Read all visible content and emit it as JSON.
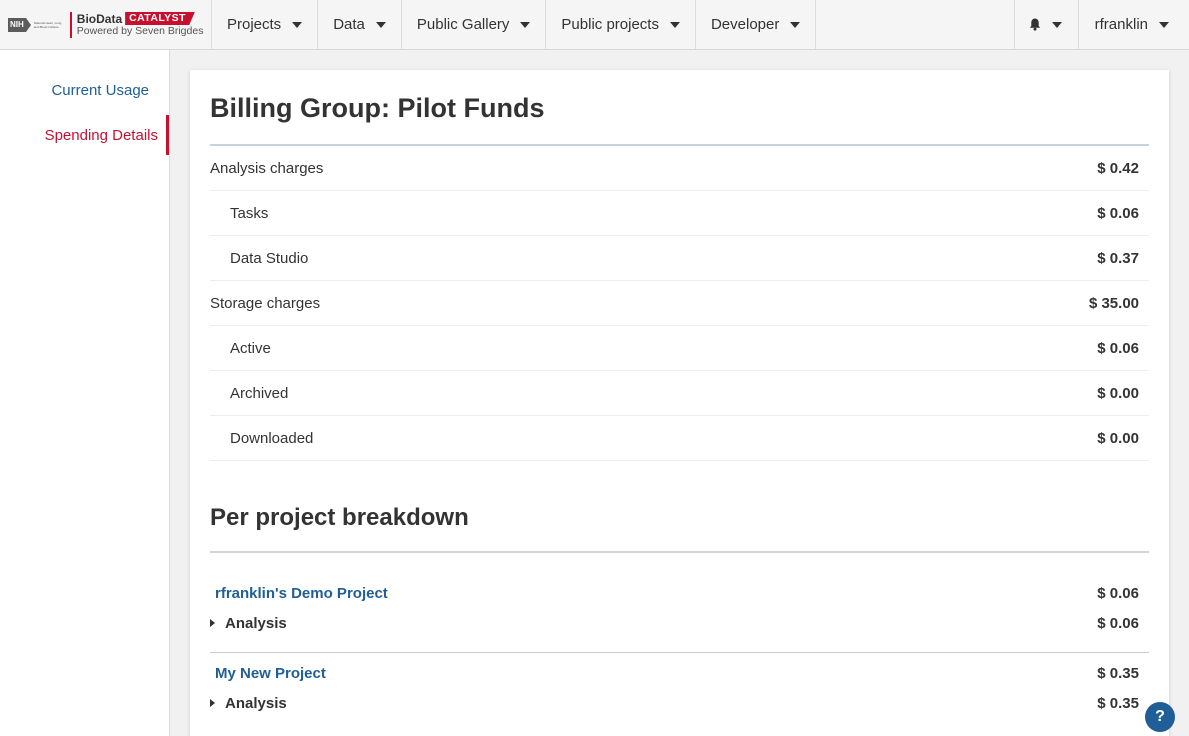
{
  "brand": {
    "nih": "NIH",
    "nih_sub": "National Heart, Lung, and Blood Institute",
    "biodata": "BioData",
    "catalyst": "CATALYST",
    "powered": "Powered by Seven Brigdes"
  },
  "nav": {
    "items": [
      {
        "label": "Projects"
      },
      {
        "label": "Data"
      },
      {
        "label": "Public Gallery"
      },
      {
        "label": "Public projects"
      },
      {
        "label": "Developer"
      }
    ],
    "user": "rfranklin",
    "bell_icon": "bell-icon"
  },
  "sidebar": {
    "items": [
      {
        "label": "Current Usage"
      },
      {
        "label": "Spending Details"
      }
    ]
  },
  "main": {
    "title": "Billing Group: Pilot Funds",
    "charges": [
      {
        "label": "Analysis charges",
        "amount": "$ 0.42"
      },
      {
        "label": "Tasks",
        "amount": "$ 0.06"
      },
      {
        "label": "Data Studio",
        "amount": "$ 0.37"
      },
      {
        "label": "Storage charges",
        "amount": "$ 35.00"
      },
      {
        "label": "Active",
        "amount": "$ 0.06"
      },
      {
        "label": "Archived",
        "amount": "$ 0.00"
      },
      {
        "label": "Downloaded",
        "amount": "$ 0.00"
      }
    ],
    "breakdown_title": "Per project breakdown",
    "projects": [
      {
        "name": "rfranklin's Demo Project",
        "amount": "$ 0.06",
        "analysis_label": "Analysis",
        "analysis_amount": "$ 0.06"
      },
      {
        "name": "My New Project",
        "amount": "$ 0.35",
        "analysis_label": "Analysis",
        "analysis_amount": "$ 0.35"
      }
    ]
  },
  "help": {
    "label": "?"
  },
  "colors": {
    "accent_red": "#c8102e",
    "link_blue": "#1f5e96"
  }
}
